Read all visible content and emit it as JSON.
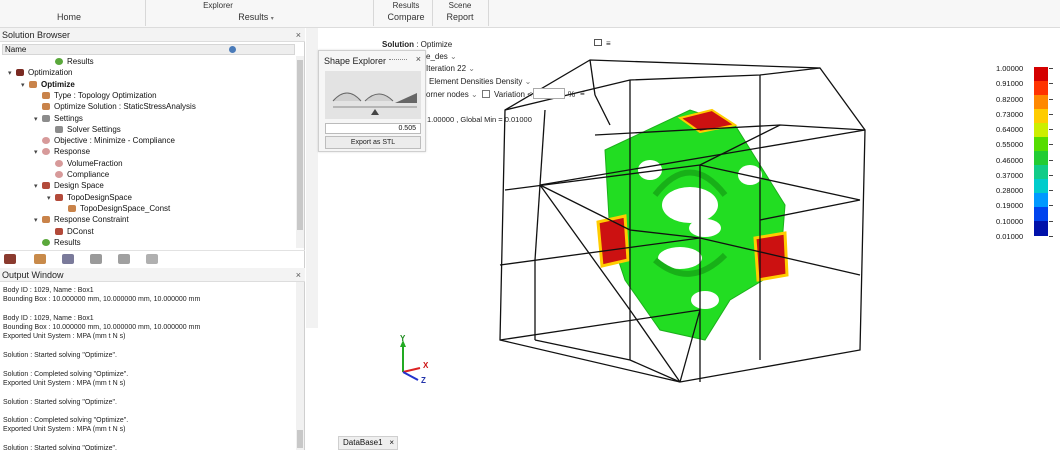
{
  "ribbon": {
    "home": "Home",
    "explorer": "Explorer",
    "results": "Results",
    "results_compare_top": "Results",
    "compare": "Compare",
    "scene_top": "Scene",
    "report": "Report"
  },
  "solution_browser": {
    "title": "Solution Browser",
    "close": "×",
    "column_name": "Name",
    "items": [
      {
        "label": "Results",
        "icon": "results-icon",
        "depth": 3,
        "arrow": ""
      },
      {
        "label": "Optimization",
        "icon": "optimization-icon",
        "depth": 0,
        "arrow": "▾"
      },
      {
        "label": "Optimize",
        "icon": "optimize-icon",
        "depth": 1,
        "arrow": "▾"
      },
      {
        "label": "Type : Topology Optimization",
        "icon": "type-icon",
        "depth": 2,
        "arrow": ""
      },
      {
        "label": "Optimize Solution : StaticStressAnalysis",
        "icon": "solution-icon",
        "depth": 2,
        "arrow": ""
      },
      {
        "label": "Settings",
        "icon": "settings-icon",
        "depth": 2,
        "arrow": "▾"
      },
      {
        "label": "Solver Settings",
        "icon": "solver-icon",
        "depth": 3,
        "arrow": ""
      },
      {
        "label": "Objective : Minimize - Compliance",
        "icon": "objective-icon",
        "depth": 2,
        "arrow": ""
      },
      {
        "label": "Response",
        "icon": "response-icon",
        "depth": 2,
        "arrow": "▾"
      },
      {
        "label": "VolumeFraction",
        "icon": "volume-icon",
        "depth": 3,
        "arrow": ""
      },
      {
        "label": "Compliance",
        "icon": "compliance-icon",
        "depth": 3,
        "arrow": ""
      },
      {
        "label": "Design Space",
        "icon": "design-space-icon",
        "depth": 2,
        "arrow": "▾"
      },
      {
        "label": "TopoDesignSpace",
        "icon": "topo-icon",
        "depth": 3,
        "arrow": "▾"
      },
      {
        "label": "TopoDesignSpace_Const",
        "icon": "topo-const-icon",
        "depth": 4,
        "arrow": ""
      },
      {
        "label": "Response Constraint",
        "icon": "constraint-icon",
        "depth": 2,
        "arrow": "▾"
      },
      {
        "label": "DConst",
        "icon": "dconst-icon",
        "depth": 3,
        "arrow": ""
      },
      {
        "label": "Results",
        "icon": "results-icon",
        "depth": 2,
        "arrow": ""
      }
    ]
  },
  "output_window": {
    "title": "Output Window",
    "close": "×",
    "text": "Body ID : 1029, Name : Box1\nBounding Box : 10.000000 mm, 10.000000 mm, 10.000000 mm\n\nBody ID : 1029, Name : Box1\nBounding Box : 10.000000 mm, 10.000000 mm, 10.000000 mm\nExported Unit System : MPA (mm t N s)\n\nSolution : Started solving \"Optimize\".\n\nSolution : Completed solving \"Optimize\".\nExported Unit System : MPA (mm t N s)\n\nSolution : Started solving \"Optimize\".\n\nSolution : Completed solving \"Optimize\".\nExported Unit System : MPA (mm t N s)\n\nSolution : Started solving \"Optimize\"."
  },
  "shape_explorer": {
    "title": "Shape Explorer",
    "close": "×",
    "value": "0.505",
    "export_button": "Export as STL"
  },
  "viewport": {
    "solution_label": "Solution",
    "solution_value": ": Optimize",
    "design": "e_des",
    "iteration": "Iteration 22",
    "result_type": "Element Densities Density",
    "corner_nodes": "orner nodes",
    "variation": "Variation <",
    "percent": "%",
    "global_range": "1.00000 , Global Min = 0.01000",
    "axis_y": "Y",
    "axis_x": "X",
    "axis_z": "Z",
    "tab": "DataBase1",
    "tab_close": "×"
  },
  "legend": {
    "values": [
      "1.00000",
      "0.91000",
      "0.82000",
      "0.73000",
      "0.64000",
      "0.55000",
      "0.46000",
      "0.37000",
      "0.28000",
      "0.19000",
      "0.10000",
      "0.01000"
    ],
    "colors": [
      "#d40000",
      "#ff3300",
      "#ff8800",
      "#ffcc00",
      "#ccee00",
      "#55dd00",
      "#22cc33",
      "#11cc88",
      "#00cccc",
      "#0099ff",
      "#0044ee",
      "#0011aa"
    ]
  }
}
